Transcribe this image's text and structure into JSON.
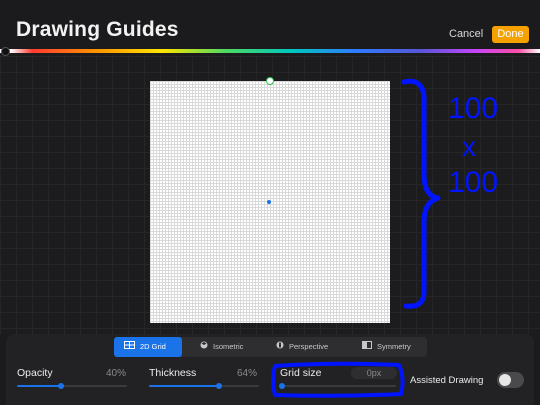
{
  "header": {
    "title": "Drawing Guides",
    "cancel_label": "Cancel",
    "done_label": "Done"
  },
  "colors": {
    "accent": "#1a73e8",
    "done": "#f5a200",
    "annotation": "#0014ff"
  },
  "annotation": {
    "lines": [
      "100",
      "x",
      "100"
    ]
  },
  "tabs": [
    {
      "label": "2D Grid",
      "icon": "grid-icon",
      "active": true
    },
    {
      "label": "Isometric",
      "icon": "cube-icon",
      "active": false
    },
    {
      "label": "Perspective",
      "icon": "perspective-icon",
      "active": false
    },
    {
      "label": "Symmetry",
      "icon": "symmetry-icon",
      "active": false
    }
  ],
  "controls": {
    "opacity": {
      "label": "Opacity",
      "value": "40%",
      "level": 0.4
    },
    "thickness": {
      "label": "Thickness",
      "value": "64%",
      "level": 0.64
    },
    "grid_size": {
      "label": "Grid size",
      "placeholder": "0px",
      "level": 0.0
    },
    "assisted_drawing": {
      "label": "Assisted Drawing",
      "on": false
    }
  }
}
